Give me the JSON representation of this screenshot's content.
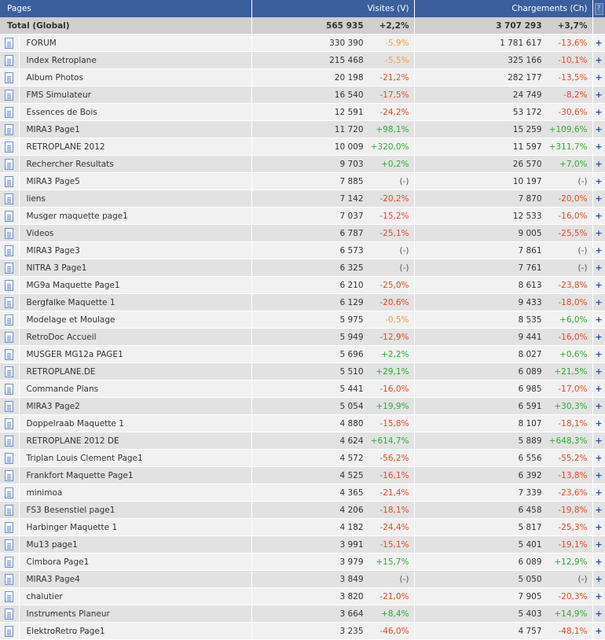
{
  "header": {
    "pages": "Pages",
    "visits": "Visites (V)",
    "loads": "Chargements (Ch)",
    "help": "?"
  },
  "total": {
    "label": "Total (Global)",
    "visits": "565 935",
    "visits_pct": "+2,2%",
    "loads": "3 707 293",
    "loads_pct": "+3,7%"
  },
  "rows": [
    {
      "name": "FORUM",
      "v": "330 390",
      "vp": "-5,9%",
      "vc": "negm",
      "c": "1 781 617",
      "cp": "-13,6%",
      "cc": "neg"
    },
    {
      "name": "Index Retroplane",
      "v": "215 468",
      "vp": "-5,5%",
      "vc": "negm",
      "c": "325 166",
      "cp": "-10,1%",
      "cc": "neg"
    },
    {
      "name": "Album Photos",
      "v": "20 198",
      "vp": "-21,2%",
      "vc": "neg",
      "c": "282 177",
      "cp": "-13,5%",
      "cc": "neg"
    },
    {
      "name": "FMS Simulateur",
      "v": "16 540",
      "vp": "-17,5%",
      "vc": "neg",
      "c": "24 749",
      "cp": "-8,2%",
      "cc": "neg"
    },
    {
      "name": "Essences de Bois",
      "v": "12 591",
      "vp": "-24,2%",
      "vc": "neg",
      "c": "53 172",
      "cp": "-30,6%",
      "cc": "neg"
    },
    {
      "name": "MIRA3 Page1",
      "v": "11 720",
      "vp": "+98,1%",
      "vc": "pos",
      "c": "15 259",
      "cp": "+109,6%",
      "cc": "pos"
    },
    {
      "name": "RETROPLANE 2012",
      "v": "10 009",
      "vp": "+320,0%",
      "vc": "pos",
      "c": "11 597",
      "cp": "+311,7%",
      "cc": "pos"
    },
    {
      "name": "Rechercher Resultats",
      "v": "9 703",
      "vp": "+0,2%",
      "vc": "pos",
      "c": "26 570",
      "cp": "+7,0%",
      "cc": "pos"
    },
    {
      "name": "MIRA3 Page5",
      "v": "7 885",
      "vp": "(-)",
      "vc": "neu",
      "c": "10 197",
      "cp": "(-)",
      "cc": "neu"
    },
    {
      "name": "liens",
      "v": "7 142",
      "vp": "-20,2%",
      "vc": "neg",
      "c": "7 870",
      "cp": "-20,0%",
      "cc": "neg"
    },
    {
      "name": "Musger maquette page1",
      "v": "7 037",
      "vp": "-15,2%",
      "vc": "neg",
      "c": "12 533",
      "cp": "-16,0%",
      "cc": "neg"
    },
    {
      "name": "Videos",
      "v": "6 787",
      "vp": "-25,1%",
      "vc": "neg",
      "c": "9 005",
      "cp": "-25,5%",
      "cc": "neg"
    },
    {
      "name": "MIRA3 Page3",
      "v": "6 573",
      "vp": "(-)",
      "vc": "neu",
      "c": "7 861",
      "cp": "(-)",
      "cc": "neu"
    },
    {
      "name": "NITRA 3 Page1",
      "v": "6 325",
      "vp": "(-)",
      "vc": "neu",
      "c": "7 761",
      "cp": "(-)",
      "cc": "neu"
    },
    {
      "name": "MG9a Maquette Page1",
      "v": "6 210",
      "vp": "-25,0%",
      "vc": "neg",
      "c": "8 613",
      "cp": "-23,8%",
      "cc": "neg"
    },
    {
      "name": "Bergfalke Maquette 1",
      "v": "6 129",
      "vp": "-20,6%",
      "vc": "neg",
      "c": "9 433",
      "cp": "-18,0%",
      "cc": "neg"
    },
    {
      "name": "Modelage et Moulage",
      "v": "5 975",
      "vp": "-0,5%",
      "vc": "negm",
      "c": "8 535",
      "cp": "+6,0%",
      "cc": "pos"
    },
    {
      "name": "RetroDoc Accueil",
      "v": "5 949",
      "vp": "-12,9%",
      "vc": "neg",
      "c": "9 441",
      "cp": "-16,0%",
      "cc": "neg"
    },
    {
      "name": "MUSGER MG12a PAGE1",
      "v": "5 696",
      "vp": "+2,2%",
      "vc": "pos",
      "c": "8 027",
      "cp": "+0,6%",
      "cc": "pos"
    },
    {
      "name": "RETROPLANE.DE",
      "v": "5 510",
      "vp": "+29,1%",
      "vc": "pos",
      "c": "6 089",
      "cp": "+21,5%",
      "cc": "pos"
    },
    {
      "name": "Commande Plans",
      "v": "5 441",
      "vp": "-16,0%",
      "vc": "neg",
      "c": "6 985",
      "cp": "-17,0%",
      "cc": "neg"
    },
    {
      "name": "MIRA3 Page2",
      "v": "5 054",
      "vp": "+19,9%",
      "vc": "pos",
      "c": "6 591",
      "cp": "+30,3%",
      "cc": "pos"
    },
    {
      "name": "Doppelraab Maquette 1",
      "v": "4 880",
      "vp": "-15,8%",
      "vc": "neg",
      "c": "8 107",
      "cp": "-18,1%",
      "cc": "neg"
    },
    {
      "name": "RETROPLANE 2012 DE",
      "v": "4 624",
      "vp": "+614,7%",
      "vc": "pos",
      "c": "5 889",
      "cp": "+648,3%",
      "cc": "pos"
    },
    {
      "name": "Triplan Louis Clement Page1",
      "v": "4 572",
      "vp": "-56,2%",
      "vc": "neg",
      "c": "6 556",
      "cp": "-55,2%",
      "cc": "neg"
    },
    {
      "name": "Frankfort Maquette Page1",
      "v": "4 525",
      "vp": "-16,1%",
      "vc": "neg",
      "c": "6 392",
      "cp": "-13,8%",
      "cc": "neg"
    },
    {
      "name": "minimoa",
      "v": "4 365",
      "vp": "-21,4%",
      "vc": "neg",
      "c": "7 339",
      "cp": "-23,6%",
      "cc": "neg"
    },
    {
      "name": "FS3 Besenstiel page1",
      "v": "4 206",
      "vp": "-18,1%",
      "vc": "neg",
      "c": "6 458",
      "cp": "-19,8%",
      "cc": "neg"
    },
    {
      "name": "Harbinger Maquette 1",
      "v": "4 182",
      "vp": "-24,4%",
      "vc": "neg",
      "c": "5 817",
      "cp": "-25,3%",
      "cc": "neg"
    },
    {
      "name": "Mu13 page1",
      "v": "3 991",
      "vp": "-15,1%",
      "vc": "neg",
      "c": "5 401",
      "cp": "-19,1%",
      "cc": "neg"
    },
    {
      "name": "Cimbora Page1",
      "v": "3 979",
      "vp": "+15,7%",
      "vc": "pos",
      "c": "6 089",
      "cp": "+12,9%",
      "cc": "pos"
    },
    {
      "name": "MIRA3 Page4",
      "v": "3 849",
      "vp": "(-)",
      "vc": "neu",
      "c": "5 050",
      "cp": "(-)",
      "cc": "neu"
    },
    {
      "name": "chalutier",
      "v": "3 820",
      "vp": "-21,0%",
      "vc": "neg",
      "c": "7 905",
      "cp": "-20,3%",
      "cc": "neg"
    },
    {
      "name": "Instruments Planeur",
      "v": "3 664",
      "vp": "+8,4%",
      "vc": "pos",
      "c": "5 403",
      "cp": "+14,9%",
      "cc": "pos"
    },
    {
      "name": "ElektroRetro Page1",
      "v": "3 235",
      "vp": "-46,0%",
      "vc": "neg",
      "c": "4 757",
      "cp": "-48,1%",
      "cc": "neg"
    }
  ]
}
